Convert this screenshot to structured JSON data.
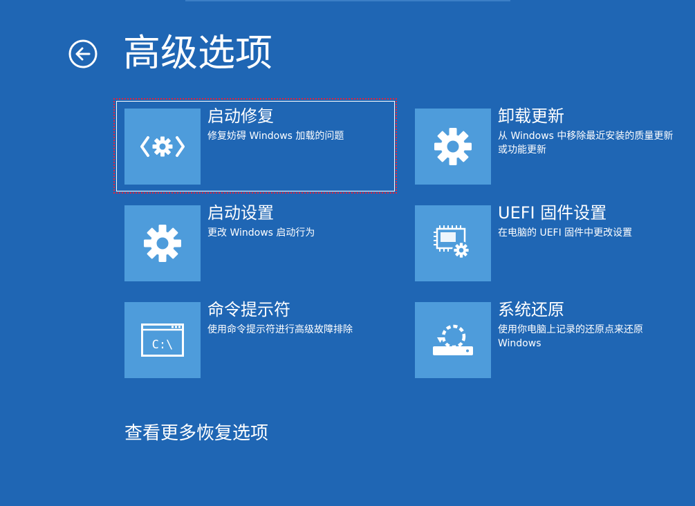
{
  "header": {
    "title": "高级选项"
  },
  "options": [
    {
      "title": "启动修复",
      "description": "修复妨碍 Windows 加载的问题",
      "icon": "startup-repair-icon"
    },
    {
      "title": "卸载更新",
      "description": "从 Windows 中移除最近安装的质量更新或功能更新",
      "icon": "gear-icon"
    },
    {
      "title": "启动设置",
      "description": "更改 Windows 启动行为",
      "icon": "gear-icon"
    },
    {
      "title": "UEFI 固件设置",
      "description": "在电脑的 UEFI 固件中更改设置",
      "icon": "chip-gear-icon"
    },
    {
      "title": "命令提示符",
      "description": "使用命令提示符进行高级故障排除",
      "icon": "command-prompt-icon"
    },
    {
      "title": "系统还原",
      "description": "使用你电脑上记录的还原点来还原 Windows",
      "icon": "system-restore-icon"
    }
  ],
  "cmd_icon_text": "C:\\",
  "footer": {
    "more_options": "查看更多恢复选项"
  },
  "colors": {
    "background": "#1f66b4",
    "tile": "#4e9cdb",
    "focus": "#e8233a"
  }
}
